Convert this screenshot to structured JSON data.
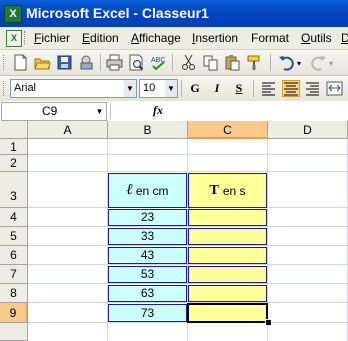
{
  "window": {
    "title": "Microsoft Excel - Classeur1",
    "icon_glyph": "X"
  },
  "menu": {
    "doc_icon_glyph": "X",
    "items": [
      {
        "key": "F",
        "rest": "ichier"
      },
      {
        "key": "E",
        "rest": "dition"
      },
      {
        "key": "A",
        "rest": "ffichage"
      },
      {
        "key": "I",
        "rest": "nsertion"
      },
      {
        "key": "",
        "rest": "Format"
      },
      {
        "key": "O",
        "rest": "utils"
      },
      {
        "key": "D",
        "rest": ""
      }
    ]
  },
  "format_toolbar": {
    "font_name": "Arial",
    "font_size": "10",
    "bold": "G",
    "italic": "I",
    "underline": "S",
    "active_alignment": "center"
  },
  "formula_bar": {
    "name_box": "C9",
    "fx_label": "fx",
    "content": ""
  },
  "sheet": {
    "columns": [
      "A",
      "B",
      "C",
      "D"
    ],
    "selected_column": "C",
    "rows": [
      "1",
      "2",
      "3",
      "4",
      "5",
      "6",
      "7",
      "8",
      "9"
    ],
    "selected_row": "9",
    "table": {
      "header_b_symbol": "ℓ",
      "header_b_text": "en cm",
      "header_c_symbol": "T",
      "header_c_text": "en s",
      "values_b": [
        "23",
        "33",
        "43",
        "53",
        "63",
        "73"
      ],
      "values_c": [
        "",
        "",
        "",
        "",
        "",
        ""
      ]
    }
  },
  "colors": {
    "title_bar": "#0446c2",
    "column_b_fill": "#ccffff",
    "column_c_fill": "#ffff99",
    "table_border": "#1c1c8c",
    "selection_header": "#f9c98b"
  }
}
